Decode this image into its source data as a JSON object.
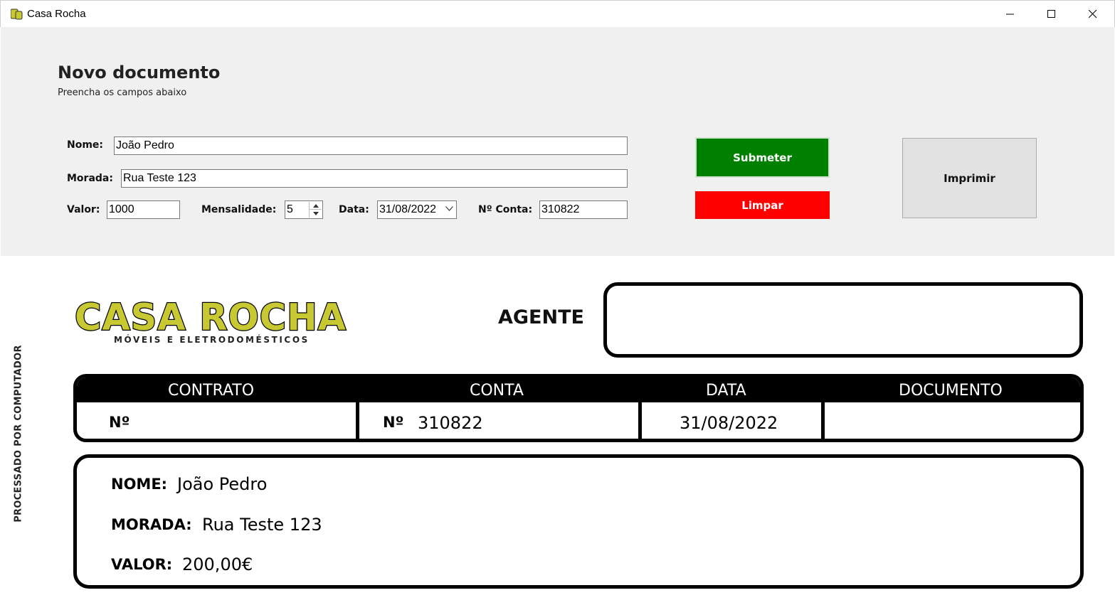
{
  "window": {
    "title": "Casa Rocha",
    "icon": "casa-rocha-app-icon",
    "controls": [
      "minimize-icon",
      "maximize-icon",
      "close-icon"
    ]
  },
  "form": {
    "title": "Novo documento",
    "subtitle": "Preencha os campos abaixo",
    "nome_label": "Nome:",
    "nome_value": "João Pedro",
    "morada_label": "Morada:",
    "morada_value": "Rua Teste 123",
    "valor_label": "Valor:",
    "valor_value": "1000",
    "mensalidade_label": "Mensalidade:",
    "mensalidade_value": "5",
    "data_label": "Data:",
    "data_value": "31/08/2022",
    "conta_label": "Nº Conta:",
    "conta_value": "310822"
  },
  "buttons": {
    "submit": "Submeter",
    "clear": "Limpar",
    "print": "Imprimir"
  },
  "document": {
    "side_text": "PROCESSADO POR COMPUTADOR",
    "logo_text": "CASA ROCHA",
    "logo_subtitle": "MÓVEIS E ELETRODOMÉSTICOS",
    "agent_label": "AGENTE",
    "agent_value": "",
    "table": {
      "headers": [
        "CONTRATO",
        "CONTA",
        "DATA",
        "DOCUMENTO"
      ],
      "contrato_prefix": "Nº",
      "contrato_value": "",
      "conta_prefix": "Nº",
      "conta_value": "310822",
      "data_value": "31/08/2022",
      "documento_value": ""
    },
    "info": {
      "nome_label": "NOME:",
      "nome_value": "João Pedro",
      "morada_label": "MORADA:",
      "morada_value": "Rua Teste 123",
      "valor_label": "VALOR:",
      "valor_value": "200,00€"
    }
  },
  "colors": {
    "submit": "#008000",
    "clear": "#ff0000",
    "print": "#e1e1e1",
    "panel": "#f0f0f0",
    "logo": "#c8c832"
  }
}
